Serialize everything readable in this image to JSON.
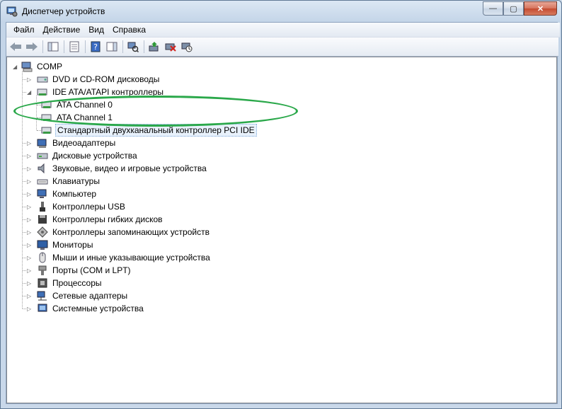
{
  "window": {
    "title": "Диспетчер устройств"
  },
  "caption_buttons": {
    "minimize": "—",
    "maximize": "▢",
    "close": "✕"
  },
  "menu": [
    "Файл",
    "Действие",
    "Вид",
    "Справка"
  ],
  "tree": {
    "root": "COMP",
    "items": [
      {
        "label": "DVD и CD-ROM дисководы",
        "icon": "dvd-drive-icon",
        "expander": "▷"
      },
      {
        "label": "IDE ATA/ATAPI контроллеры",
        "icon": "ide-controller-icon",
        "expander": "◢"
      },
      {
        "label": "ATA Channel 0",
        "icon": "ide-controller-icon",
        "child": true
      },
      {
        "label": "ATA Channel 1",
        "icon": "ide-controller-icon",
        "child": true
      },
      {
        "label": "Стандартный двухканальный контроллер PCI IDE",
        "icon": "ide-controller-icon",
        "child": true,
        "selected": true
      },
      {
        "label": "Видеоадаптеры",
        "icon": "display-adapter-icon",
        "expander": "▷"
      },
      {
        "label": "Дисковые устройства",
        "icon": "disk-drive-icon",
        "expander": "▷"
      },
      {
        "label": "Звуковые, видео и игровые устройства",
        "icon": "speaker-icon",
        "expander": "▷"
      },
      {
        "label": "Клавиатуры",
        "icon": "keyboard-icon",
        "expander": "▷"
      },
      {
        "label": "Компьютер",
        "icon": "computer-icon",
        "expander": "▷"
      },
      {
        "label": "Контроллеры USB",
        "icon": "usb-icon",
        "expander": "▷"
      },
      {
        "label": "Контроллеры гибких дисков",
        "icon": "floppy-controller-icon",
        "expander": "▷"
      },
      {
        "label": "Контроллеры запоминающих устройств",
        "icon": "storage-controller-icon",
        "expander": "▷"
      },
      {
        "label": "Мониторы",
        "icon": "monitor-icon",
        "expander": "▷"
      },
      {
        "label": "Мыши и иные указывающие устройства",
        "icon": "mouse-icon",
        "expander": "▷"
      },
      {
        "label": "Порты (COM и LPT)",
        "icon": "port-icon",
        "expander": "▷"
      },
      {
        "label": "Процессоры",
        "icon": "processor-icon",
        "expander": "▷"
      },
      {
        "label": "Сетевые адаптеры",
        "icon": "network-adapter-icon",
        "expander": "▷"
      },
      {
        "label": "Системные устройства",
        "icon": "system-device-icon",
        "expander": "▷"
      }
    ]
  },
  "annotation": {
    "color": "#2aa84a"
  }
}
